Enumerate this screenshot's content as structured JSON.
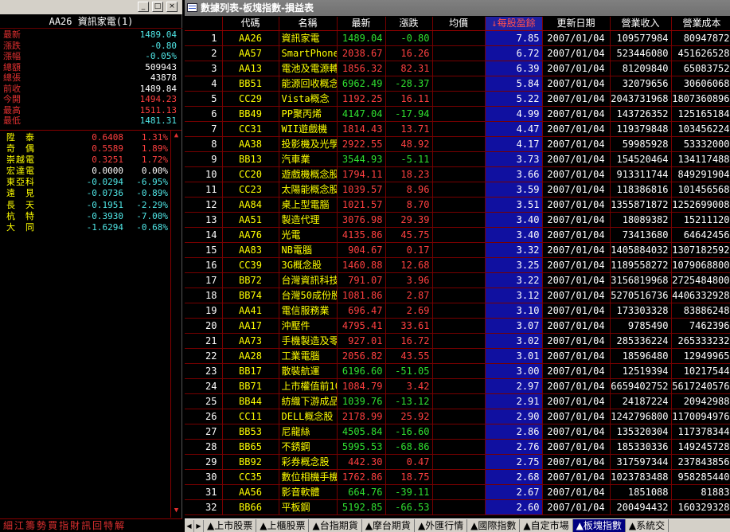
{
  "left_panel": {
    "window_buttons": [
      "_",
      "□",
      "×"
    ],
    "header": "AA26 資訊家電(1)",
    "quote": [
      {
        "label": "最新",
        "value": "1489.04",
        "color": "cyan"
      },
      {
        "label": "漲跌",
        "value": "-0.80",
        "color": "cyan"
      },
      {
        "label": "漲幅",
        "value": "-0.05%",
        "color": "cyan"
      },
      {
        "label": "總額",
        "value": "509943",
        "color": "white"
      },
      {
        "label": "總張",
        "value": "43878",
        "color": "white"
      },
      {
        "label": "前收",
        "value": "1489.84",
        "color": "white"
      },
      {
        "label": "今開",
        "value": "1494.23",
        "color": "red"
      },
      {
        "label": "最高",
        "value": "1511.13",
        "color": "red"
      },
      {
        "label": "最低",
        "value": "1481.31",
        "color": "cyan"
      }
    ],
    "constituents": [
      {
        "name": "陞　泰",
        "change": "0.6408",
        "pct": "1.31%",
        "dir": "up"
      },
      {
        "name": "奇　偶",
        "change": "0.5589",
        "pct": "1.89%",
        "dir": "up"
      },
      {
        "name": "崇越電",
        "change": "0.3251",
        "pct": "1.72%",
        "dir": "up"
      },
      {
        "name": "宏達電",
        "change": "0.0000",
        "pct": "0.00%",
        "dir": "flat"
      },
      {
        "name": "東亞科",
        "change": "-0.0294",
        "pct": "-6.95%",
        "dir": "dn"
      },
      {
        "name": "遠　見",
        "change": "-0.0736",
        "pct": "-0.89%",
        "dir": "dn"
      },
      {
        "name": "長　天",
        "change": "-0.1951",
        "pct": "-2.29%",
        "dir": "dn"
      },
      {
        "name": "杭　特",
        "change": "-0.3930",
        "pct": "-7.00%",
        "dir": "dn"
      },
      {
        "name": "大　同",
        "change": "-1.6294",
        "pct": "-0.68%",
        "dir": "dn"
      }
    ],
    "bottom_tabs": [
      "細",
      "江",
      "籌",
      "勢",
      "買",
      "指",
      "財",
      "訊",
      "回",
      "特",
      "解"
    ]
  },
  "right_panel": {
    "title": "數據列表-板塊指數-損益表",
    "columns": [
      "",
      "代碼",
      "名稱",
      "最新",
      "漲跌",
      "均價",
      "↓每股盈餘",
      "更新日期",
      "營業收入",
      "營業成本"
    ],
    "rows": [
      [
        "1",
        "AA26",
        "資訊家電",
        "1489.04",
        "-0.80",
        "",
        "7.85",
        "2007/01/04",
        "109577984",
        "80947872"
      ],
      [
        "2",
        "AA57",
        "SmartPhone",
        "2038.67",
        "16.26",
        "",
        "6.72",
        "2007/01/04",
        "523446080",
        "451626528"
      ],
      [
        "3",
        "AA13",
        "電池及電源轉",
        "1856.32",
        "82.31",
        "",
        "6.39",
        "2007/01/04",
        "81209840",
        "65083752"
      ],
      [
        "4",
        "BB51",
        "能源回收概念",
        "6962.49",
        "-28.37",
        "",
        "5.84",
        "2007/01/04",
        "32079656",
        "30606068"
      ],
      [
        "5",
        "CC29",
        "Vista概念",
        "1192.25",
        "16.11",
        "",
        "5.22",
        "2007/01/04",
        "2043731968",
        "1807360896"
      ],
      [
        "6",
        "BB49",
        "PP聚丙烯",
        "4147.04",
        "-17.94",
        "",
        "4.99",
        "2007/01/04",
        "143726352",
        "125165184"
      ],
      [
        "7",
        "CC31",
        "WII遊戲機",
        "1814.43",
        "13.71",
        "",
        "4.47",
        "2007/01/04",
        "119379848",
        "103456224"
      ],
      [
        "8",
        "AA38",
        "投影機及光學",
        "2922.55",
        "48.92",
        "",
        "4.17",
        "2007/01/04",
        "59985928",
        "53332000"
      ],
      [
        "9",
        "BB13",
        "汽車業",
        "3544.93",
        "-5.11",
        "",
        "3.73",
        "2007/01/04",
        "154520464",
        "134117488"
      ],
      [
        "10",
        "CC20",
        "遊戲機概念股",
        "1794.11",
        "18.23",
        "",
        "3.66",
        "2007/01/04",
        "913311744",
        "849291904"
      ],
      [
        "11",
        "CC23",
        "太陽能概念股",
        "1039.57",
        "8.96",
        "",
        "3.59",
        "2007/01/04",
        "118386816",
        "101456568"
      ],
      [
        "12",
        "AA84",
        "桌上型電腦",
        "1021.57",
        "8.70",
        "",
        "3.51",
        "2007/01/04",
        "1355871872",
        "1252699008"
      ],
      [
        "13",
        "AA51",
        "製造代理",
        "3076.98",
        "29.39",
        "",
        "3.40",
        "2007/01/04",
        "18089382",
        "15211120"
      ],
      [
        "14",
        "AA76",
        "光電",
        "4135.86",
        "45.75",
        "",
        "3.40",
        "2007/01/04",
        "73413680",
        "64642456"
      ],
      [
        "15",
        "AA83",
        "NB電腦",
        "904.67",
        "0.17",
        "",
        "3.32",
        "2007/01/04",
        "1405884032",
        "1307182592"
      ],
      [
        "16",
        "CC39",
        "3G概念股",
        "1460.88",
        "12.68",
        "",
        "3.25",
        "2007/01/04",
        "1189558272",
        "1079068800"
      ],
      [
        "17",
        "BB72",
        "台灣資訊科技",
        "791.07",
        "3.96",
        "",
        "3.22",
        "2007/01/04",
        "3156819968",
        "2725484800"
      ],
      [
        "18",
        "BB74",
        "台灣50成份股",
        "1081.86",
        "2.87",
        "",
        "3.12",
        "2007/01/04",
        "5270516736",
        "4406332928"
      ],
      [
        "19",
        "AA41",
        "電信服務業",
        "696.47",
        "2.69",
        "",
        "3.10",
        "2007/01/04",
        "173303328",
        "83886248"
      ],
      [
        "20",
        "AA17",
        "沖壓件",
        "4795.41",
        "33.61",
        "",
        "3.07",
        "2007/01/04",
        "9785490",
        "7462396"
      ],
      [
        "21",
        "AA73",
        "手機製造及零",
        "927.01",
        "16.72",
        "",
        "3.02",
        "2007/01/04",
        "285336224",
        "265333232"
      ],
      [
        "22",
        "AA28",
        "工業電腦",
        "2056.82",
        "43.55",
        "",
        "3.01",
        "2007/01/04",
        "18596480",
        "12949965"
      ],
      [
        "23",
        "BB17",
        "散裝航運",
        "6196.60",
        "-51.05",
        "",
        "3.00",
        "2007/01/04",
        "12519394",
        "10217544"
      ],
      [
        "24",
        "BB71",
        "上市權值前10",
        "1084.79",
        "3.42",
        "",
        "2.97",
        "2007/01/04",
        "6659402752",
        "5617240576"
      ],
      [
        "25",
        "BB44",
        "紡織下游成品",
        "1039.76",
        "-13.12",
        "",
        "2.91",
        "2007/01/04",
        "24187224",
        "20942988"
      ],
      [
        "26",
        "CC11",
        "DELL概念股",
        "2178.99",
        "25.92",
        "",
        "2.90",
        "2007/01/04",
        "1242796800",
        "1170094976"
      ],
      [
        "27",
        "BB53",
        "尼龍絲",
        "4505.84",
        "-16.60",
        "",
        "2.86",
        "2007/01/04",
        "135320304",
        "117378344"
      ],
      [
        "28",
        "BB65",
        "不銹鋼",
        "5995.53",
        "-68.86",
        "",
        "2.76",
        "2007/01/04",
        "185330336",
        "149245728"
      ],
      [
        "29",
        "BB92",
        "彩券概念股",
        "442.30",
        "0.47",
        "",
        "2.75",
        "2007/01/04",
        "317597344",
        "237843856"
      ],
      [
        "30",
        "CC35",
        "數位相機手機",
        "1762.86",
        "18.75",
        "",
        "2.68",
        "2007/01/04",
        "1023783488",
        "958285440"
      ],
      [
        "31",
        "AA56",
        "影音軟體",
        "664.76",
        "-39.11",
        "",
        "2.67",
        "2007/01/04",
        "1851088",
        "81883"
      ],
      [
        "32",
        "BB66",
        "平板鋼",
        "5192.85",
        "-66.53",
        "",
        "2.60",
        "2007/01/04",
        "200494432",
        "160329328"
      ]
    ],
    "tabs": [
      "▲上市股票",
      "▲上櫃股票",
      "▲台指期貨",
      "▲摩台期貨",
      "▲外匯行情",
      "▲國際指數",
      "▲自定市場",
      "▲板塊指數",
      "▲系統交"
    ],
    "active_tab": 7
  }
}
